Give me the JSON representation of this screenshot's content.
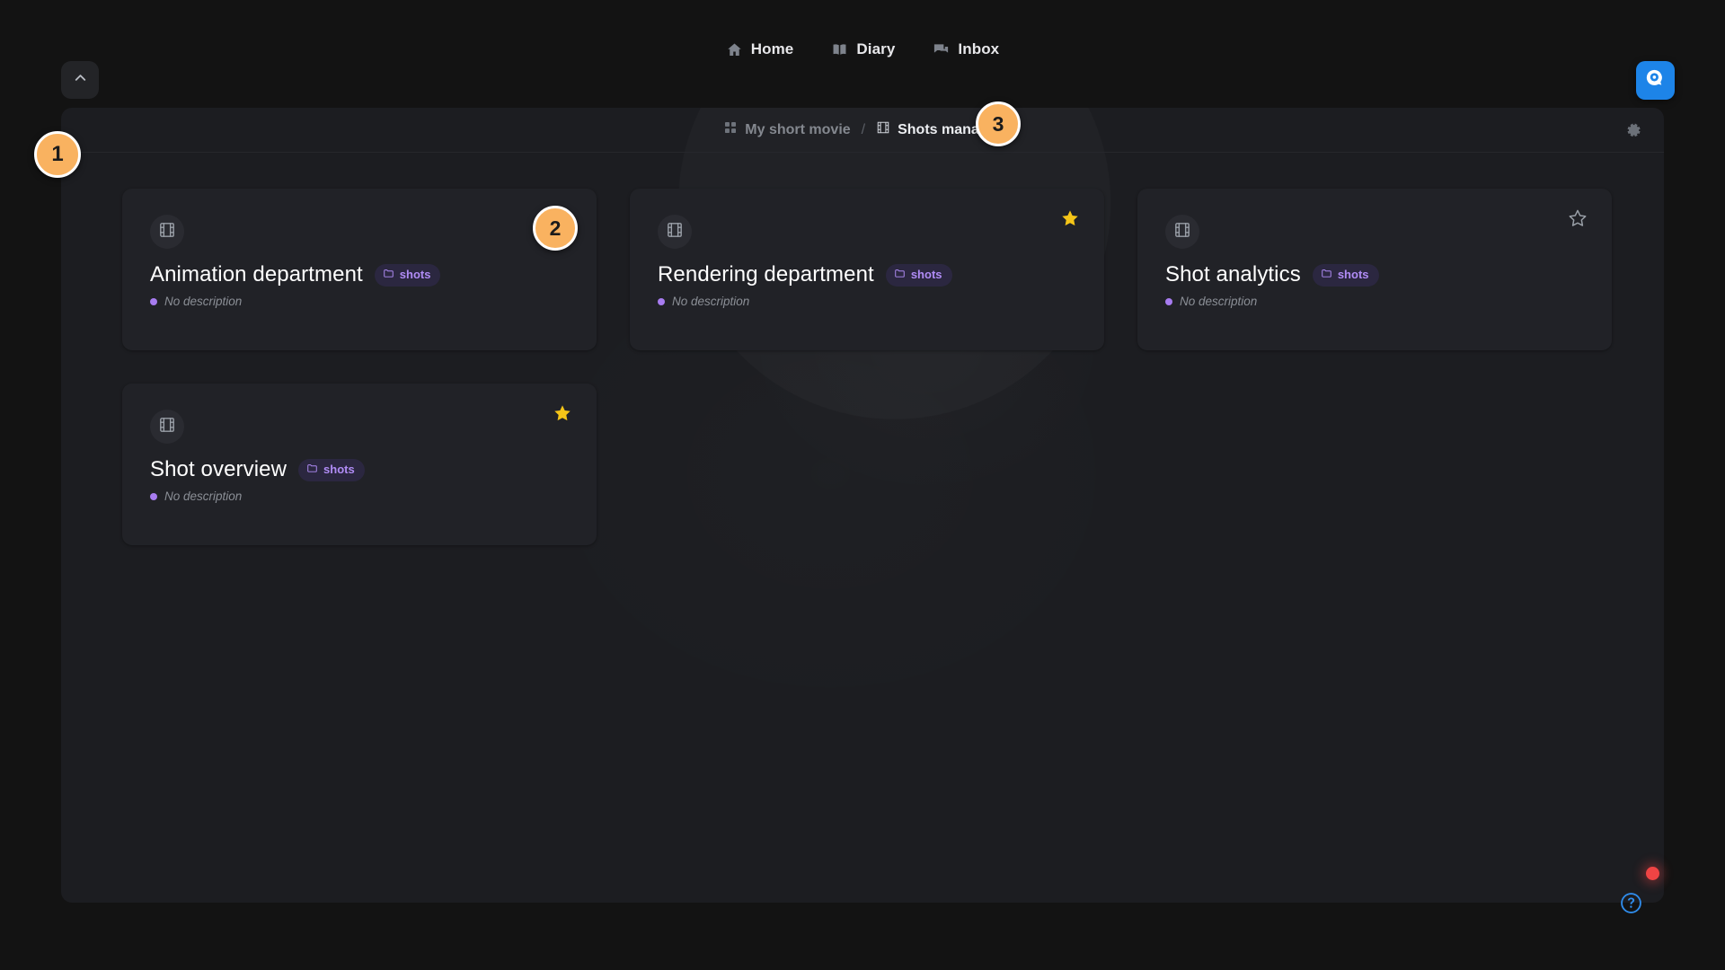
{
  "topbar": {
    "collapse_icon": "chevron-up-icon",
    "nav_items": [
      {
        "label": "Home",
        "icon": "home-icon"
      },
      {
        "label": "Diary",
        "icon": "book-icon"
      },
      {
        "label": "Inbox",
        "icon": "chat-icon"
      }
    ],
    "app_button_icon": "chat-bubble-logo-icon"
  },
  "breadcrumb": {
    "parent": "My short movie",
    "parent_icon": "grid-icon",
    "separator": "/",
    "current": "Shots manager",
    "current_icon": "film-icon",
    "settings_icon": "gear-icon"
  },
  "cards": [
    {
      "title": "Animation department",
      "tag": "shots",
      "tag_icon": "folder-icon",
      "description": "No description",
      "icon": "film-icon",
      "starred": false,
      "star_visible": false
    },
    {
      "title": "Rendering department",
      "tag": "shots",
      "tag_icon": "folder-icon",
      "description": "No description",
      "icon": "film-icon",
      "starred": true,
      "star_visible": true
    },
    {
      "title": "Shot analytics",
      "tag": "shots",
      "tag_icon": "folder-icon",
      "description": "No description",
      "icon": "film-icon",
      "starred": false,
      "star_visible": true
    },
    {
      "title": "Shot overview",
      "tag": "shots",
      "tag_icon": "folder-icon",
      "description": "No description",
      "icon": "film-icon",
      "starred": true,
      "star_visible": true
    }
  ],
  "annotations": [
    {
      "number": "1"
    },
    {
      "number": "2"
    },
    {
      "number": "3"
    }
  ],
  "footer": {
    "help_icon": "help-circle-icon",
    "recording_indicator": "record-dot-icon"
  },
  "colors": {
    "page_background": "#131313",
    "panel_background": "#1c1d21",
    "card_background": "#212227",
    "tag_text": "#b08cf5",
    "tag_background": "#2b2740",
    "star_filled": "#f5c518",
    "star_outline": "#9aa0a8",
    "accent_blue": "#1d84e8",
    "annotation_badge": "#f9b260",
    "record_red": "#ef4444"
  }
}
